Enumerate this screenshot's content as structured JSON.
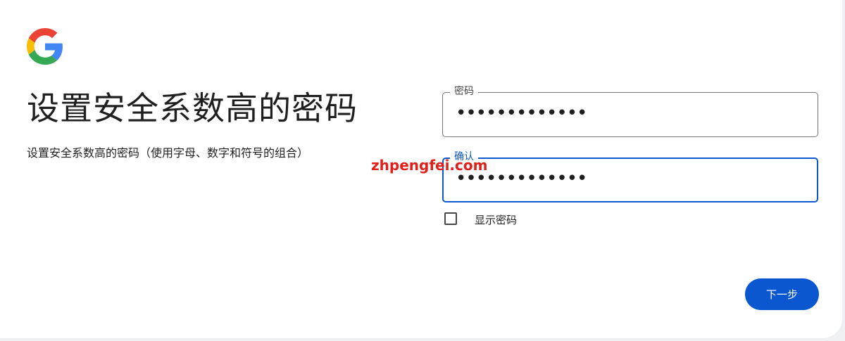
{
  "brand": {
    "logo": "google-logo",
    "colors": {
      "blue": "#4285F4",
      "red": "#EA4335",
      "yellow": "#FBBC05",
      "green": "#34A853"
    }
  },
  "page": {
    "title": "设置安全系数高的密码",
    "subtitle": "设置安全系数高的密码（使用字母、数字和符号的组合）"
  },
  "form": {
    "password": {
      "label": "密码",
      "value": "•••••••••••••"
    },
    "confirm": {
      "label": "确认",
      "value": "•••••••••••••",
      "focused": true
    },
    "show_password": {
      "label": "显示密码",
      "checked": false
    }
  },
  "actions": {
    "next_label": "下一步"
  },
  "watermark": {
    "text": "zhpengfei.com"
  },
  "theme": {
    "accent": "#0b57d0",
    "text": "#1f1f1f",
    "border": "#747775",
    "watermark": "#e0201a"
  }
}
